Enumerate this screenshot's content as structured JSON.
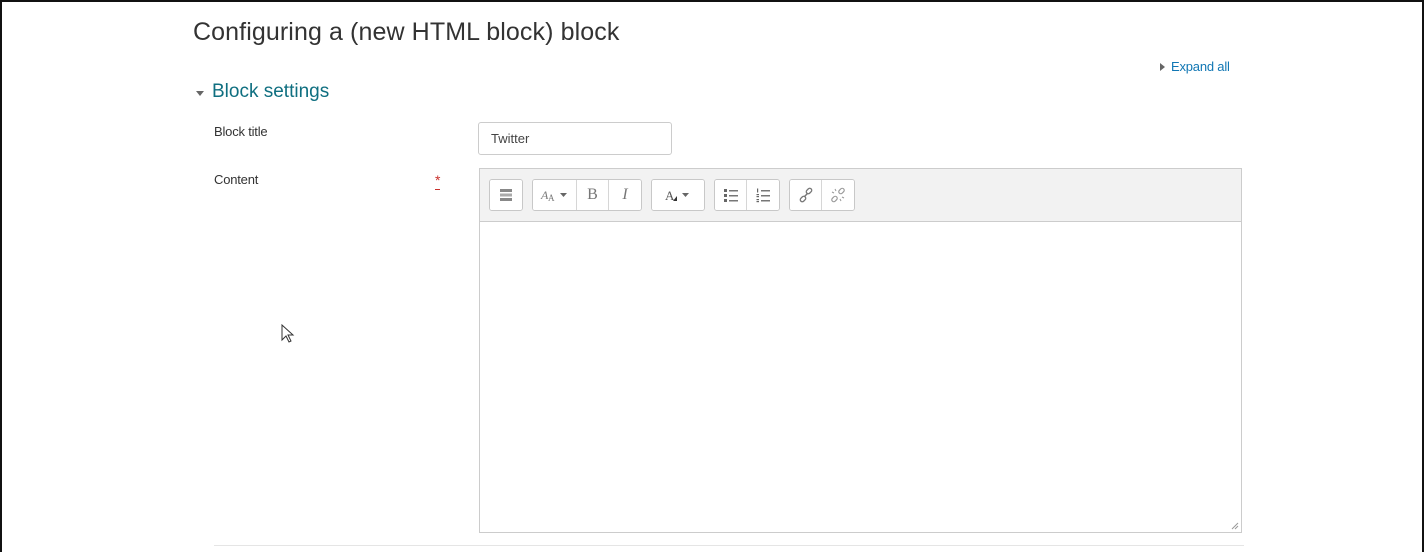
{
  "page": {
    "title": "Configuring a (new HTML block) block",
    "expand_all": "Expand all"
  },
  "section": {
    "title": "Block settings"
  },
  "fields": {
    "block_title": {
      "label": "Block title",
      "value": "Twitter"
    },
    "content": {
      "label": "Content",
      "required_marker": "*"
    }
  },
  "toolbar": {
    "groups": [
      [
        "show-more-buttons-icon"
      ],
      [
        "paragraph-styles-icon",
        "bold-icon",
        "italic-icon"
      ],
      [
        "text-color-icon"
      ],
      [
        "unordered-list-icon",
        "ordered-list-icon"
      ],
      [
        "link-icon",
        "unlink-icon"
      ]
    ],
    "bold_glyph": "B",
    "italic_glyph": "I"
  },
  "colors": {
    "link": "#1177b4",
    "section": "#0f6f80",
    "required": "#c9302c",
    "toolbar_bg": "#f2f2f2"
  }
}
